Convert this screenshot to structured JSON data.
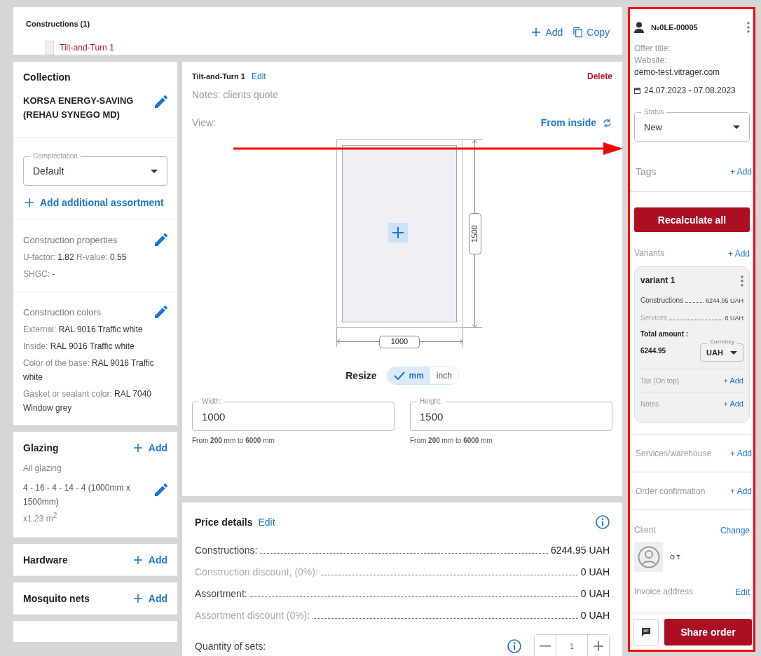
{
  "constructions_bar": {
    "title": "Constructions (1)",
    "items": [
      {
        "label": "Tilt-and-Turn 1",
        "selected": true
      }
    ],
    "actions": [
      {
        "kind": "add",
        "label": "Add"
      },
      {
        "kind": "copy",
        "label": "Copy"
      }
    ]
  },
  "sidebar": {
    "collection": {
      "title": "Collection",
      "name": "KORSA ENERGY-SAVING (REHAU SYNEGO MD)"
    },
    "complectation": {
      "label": "Complectation",
      "value": "Default"
    },
    "add_assortment": "Add additional assortment",
    "groups": [
      {
        "title": "Construction properties",
        "lines": [
          {
            "parts": [
              {
                "label": "U-factor:",
                "value": "1.82"
              },
              {
                "label": "R-value:",
                "value": "0.55"
              }
            ]
          },
          {
            "parts": [
              {
                "label": "SHGC:",
                "value": "-"
              }
            ]
          }
        ]
      },
      {
        "title": "Construction colors",
        "lines": [
          {
            "parts": [
              {
                "label": "External:",
                "value": "RAL 9016 Traffic white"
              }
            ]
          },
          {
            "parts": [
              {
                "label": "Inside:",
                "value": "RAL 9016 Traffic white"
              }
            ]
          },
          {
            "parts": [
              {
                "label": "Color of the base:",
                "value": "RAL 9016 Traffic white"
              }
            ]
          },
          {
            "parts": [
              {
                "label": "Gasket or sealant color:",
                "value": "RAL 7040 Window grey"
              }
            ]
          }
        ]
      }
    ],
    "glazing": {
      "title": "Glazing",
      "add": "Add",
      "subtitle": "All glazing",
      "item": "4 - 16 - 4 - 14 - 4 (1000mm x 1500mm)",
      "area": "x1.23 m$^{2}$"
    },
    "sections": [
      {
        "title": "Hardware",
        "add": "Add"
      },
      {
        "title": "Mosquito nets",
        "add": "Add"
      }
    ]
  },
  "editor": {
    "name": "Tilt-and-Turn 1",
    "edit": "Edit",
    "delete": "Delete",
    "notes": "Notes: clients quote",
    "view_label": "View:",
    "view_side": "From inside",
    "width_dim": "1000",
    "height_dim": "1500",
    "resize_label": "Resize",
    "units": [
      {
        "label": "mm",
        "selected": true
      },
      {
        "label": "inch",
        "selected": false
      }
    ],
    "fields": [
      {
        "label": "Width:",
        "value": "1000",
        "hint": "From **200** mm to **6000** mm"
      },
      {
        "label": "Height:",
        "value": "1500",
        "hint": "From **200** mm to **6000** mm"
      }
    ]
  },
  "price": {
    "title": "Price details",
    "edit": "Edit",
    "rows": [
      {
        "label": "Constructions:",
        "value": "6244.95 UAH",
        "muted": false
      },
      {
        "label": "Construction discount, (0%):",
        "value": "0 UAH",
        "muted": true
      },
      {
        "label": "Assortment:",
        "value": "0 UAH",
        "muted": false
      },
      {
        "label": "Assortment discount (0%):",
        "value": "0 UAH",
        "muted": true
      }
    ],
    "quantity_label": "Quantity of sets:",
    "quantity": "1"
  },
  "order": {
    "number": "№0LE-00005",
    "offer_title": "Offer title:",
    "website_label": "Website:",
    "website": "demo-test.vitrager.com",
    "dates": "24.07.2023 - 07.08.2023",
    "status": {
      "label": "Status",
      "value": "New"
    },
    "tags": {
      "label": "Tags",
      "add": "+ Add"
    },
    "recalculate": "Recalculate all",
    "variants": {
      "label": "Variants",
      "add": "+ Add",
      "items": [
        {
          "name": "variant 1",
          "rows": [
            {
              "label": "Constructions",
              "value": "6244.95 UAH",
              "muted": false
            },
            {
              "label": "Services",
              "value": "0 UAH",
              "muted": true
            }
          ],
          "total_label": "Total amount :",
          "total": "6244.95",
          "currency": {
            "label": "Currency",
            "value": "UAH"
          },
          "extras": [
            {
              "label": "Tax (On top)",
              "add": "+ Add"
            },
            {
              "label": "Notes",
              "add": "+ Add"
            }
          ]
        }
      ]
    },
    "sections": [
      {
        "label": "Services/warehouse",
        "add": "+ Add"
      },
      {
        "label": "Order confirmation",
        "add": "+ Add"
      }
    ],
    "client": {
      "label": "Client",
      "change": "Change",
      "name": "O T"
    },
    "invoice": {
      "label": "Invoice address",
      "edit": "Edit"
    },
    "share": "Share order"
  }
}
